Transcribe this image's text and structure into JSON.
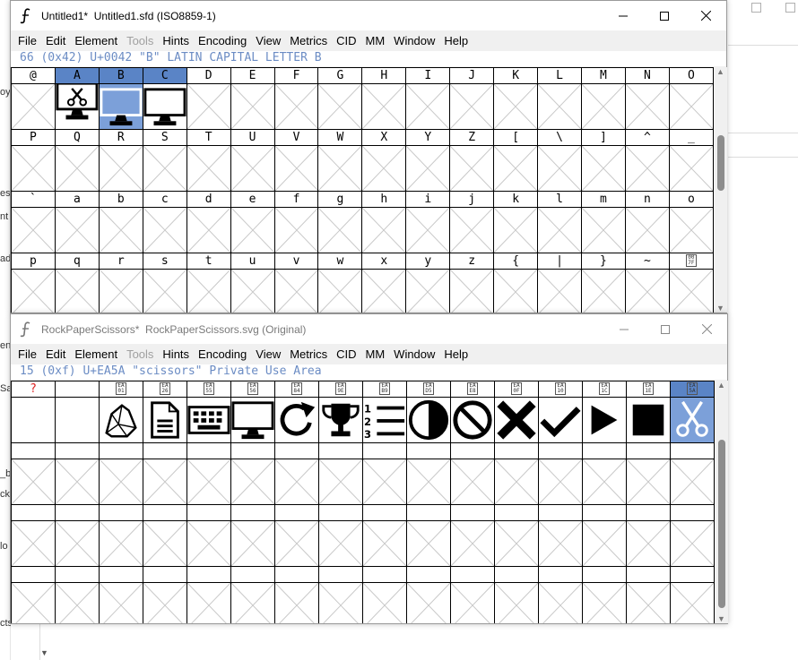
{
  "background": {
    "left_fragments": [
      "oy",
      "es",
      "nt",
      "ad",
      "en",
      "Sa",
      "_ba",
      "ck",
      "lo",
      "cts"
    ]
  },
  "window1": {
    "title": "Untitled1*  Untitled1.sfd (ISO8859-1)",
    "menu": [
      "File",
      "Edit",
      "Element",
      "Tools",
      "Hints",
      "Encoding",
      "View",
      "Metrics",
      "CID",
      "MM",
      "Window",
      "Help"
    ],
    "disabled_menu": [
      "Tools"
    ],
    "info": "66 (0x42) U+0042 \"B\" LATIN CAPITAL LETTER B",
    "rows": [
      [
        "@",
        "A",
        "B",
        "C",
        "D",
        "E",
        "F",
        "G",
        "H",
        "I",
        "J",
        "K",
        "L",
        "M",
        "N",
        "O"
      ],
      [
        "P",
        "Q",
        "R",
        "S",
        "T",
        "U",
        "V",
        "W",
        "X",
        "Y",
        "Z",
        "[",
        "\\",
        "]",
        "^",
        "_"
      ],
      [
        "`",
        "a",
        "b",
        "c",
        "d",
        "e",
        "f",
        "g",
        "h",
        "i",
        "j",
        "k",
        "l",
        "m",
        "n",
        "o"
      ],
      [
        "p",
        "q",
        "r",
        "s",
        "t",
        "u",
        "v",
        "w",
        "x",
        "y",
        "z",
        "{",
        "|",
        "}",
        "~",
        "007F"
      ]
    ],
    "glyph_cells": {
      "A": "scissors-monitor-icon",
      "B": "monitor-icon",
      "C": "monitor-icon"
    },
    "selected": "B"
  },
  "window2": {
    "title": "RockPaperScissors*  RockPaperScissors.svg (Original)",
    "menu": [
      "File",
      "Edit",
      "Element",
      "Tools",
      "Hints",
      "Encoding",
      "View",
      "Metrics",
      "CID",
      "MM",
      "Window",
      "Help"
    ],
    "disabled_menu": [
      "Tools"
    ],
    "info": "15 (0xf) U+EA5A \"scissors\" Private Use Area",
    "label_row": [
      "?",
      "",
      "EA01",
      "EA26",
      "EA55",
      "EA56",
      "EA84",
      "EA9E",
      "EAB9",
      "EAD5",
      "EAE8",
      "EA0F",
      "EA10",
      "EA1C",
      "EA1E",
      "EA5A"
    ],
    "glyphs": [
      "",
      "",
      "rock-icon",
      "paper-icon",
      "keyboard-icon",
      "monitor-icon",
      "redo-icon",
      "trophy-icon",
      "numbered-list-icon",
      "contrast-icon",
      "ban-icon",
      "x-mark-icon",
      "checkmark-icon",
      "play-icon",
      "stop-icon",
      "scissors-icon"
    ],
    "selected_index": 15,
    "empty_rows": 3
  }
}
